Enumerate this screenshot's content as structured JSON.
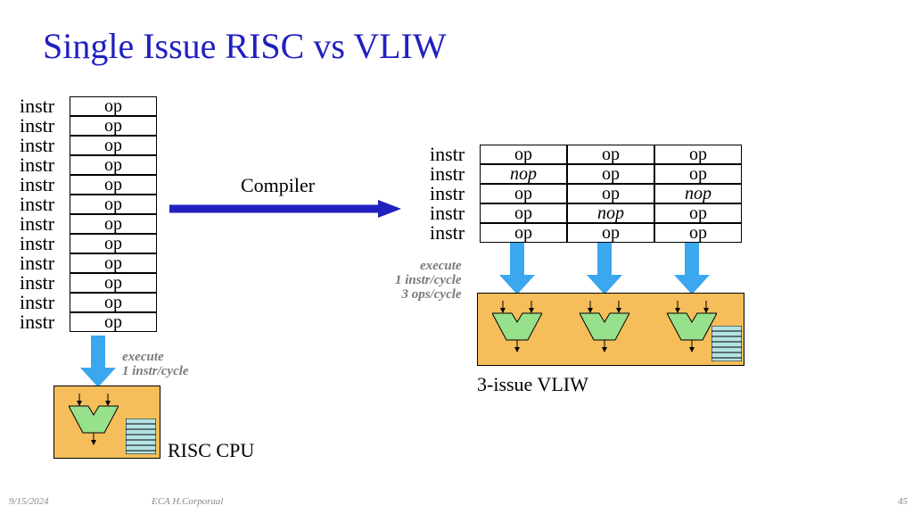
{
  "title": "Single Issue RISC vs VLIW",
  "risc": {
    "rows": [
      {
        "label": "instr",
        "op": "op"
      },
      {
        "label": "instr",
        "op": "op"
      },
      {
        "label": "instr",
        "op": "op"
      },
      {
        "label": "instr",
        "op": "op"
      },
      {
        "label": "instr",
        "op": "op"
      },
      {
        "label": "instr",
        "op": "op"
      },
      {
        "label": "instr",
        "op": "op"
      },
      {
        "label": "instr",
        "op": "op"
      },
      {
        "label": "instr",
        "op": "op"
      },
      {
        "label": "instr",
        "op": "op"
      },
      {
        "label": "instr",
        "op": "op"
      },
      {
        "label": "instr",
        "op": "op"
      }
    ],
    "exec_label_line1": "execute",
    "exec_label_line2": "1 instr/cycle",
    "cpu_label": "RISC CPU"
  },
  "vliw": {
    "rows": [
      {
        "label": "instr",
        "ops": [
          "op",
          "op",
          "op"
        ],
        "nop": [
          false,
          false,
          false
        ]
      },
      {
        "label": "instr",
        "ops": [
          "nop",
          "op",
          "op"
        ],
        "nop": [
          true,
          false,
          false
        ]
      },
      {
        "label": "instr",
        "ops": [
          "op",
          "op",
          "nop"
        ],
        "nop": [
          false,
          false,
          true
        ]
      },
      {
        "label": "instr",
        "ops": [
          "op",
          "nop",
          "op"
        ],
        "nop": [
          false,
          true,
          false
        ]
      },
      {
        "label": "instr",
        "ops": [
          "op",
          "op",
          "op"
        ],
        "nop": [
          false,
          false,
          false
        ]
      }
    ],
    "exec_label_line1": "execute",
    "exec_label_line2": "1 instr/cycle",
    "exec_label_line3": "3 ops/cycle",
    "cpu_label": "3-issue VLIW"
  },
  "compiler_label": "Compiler",
  "footer": {
    "date": "9/15/2024",
    "author": "ECA  H.Corporaal",
    "page": "45"
  }
}
